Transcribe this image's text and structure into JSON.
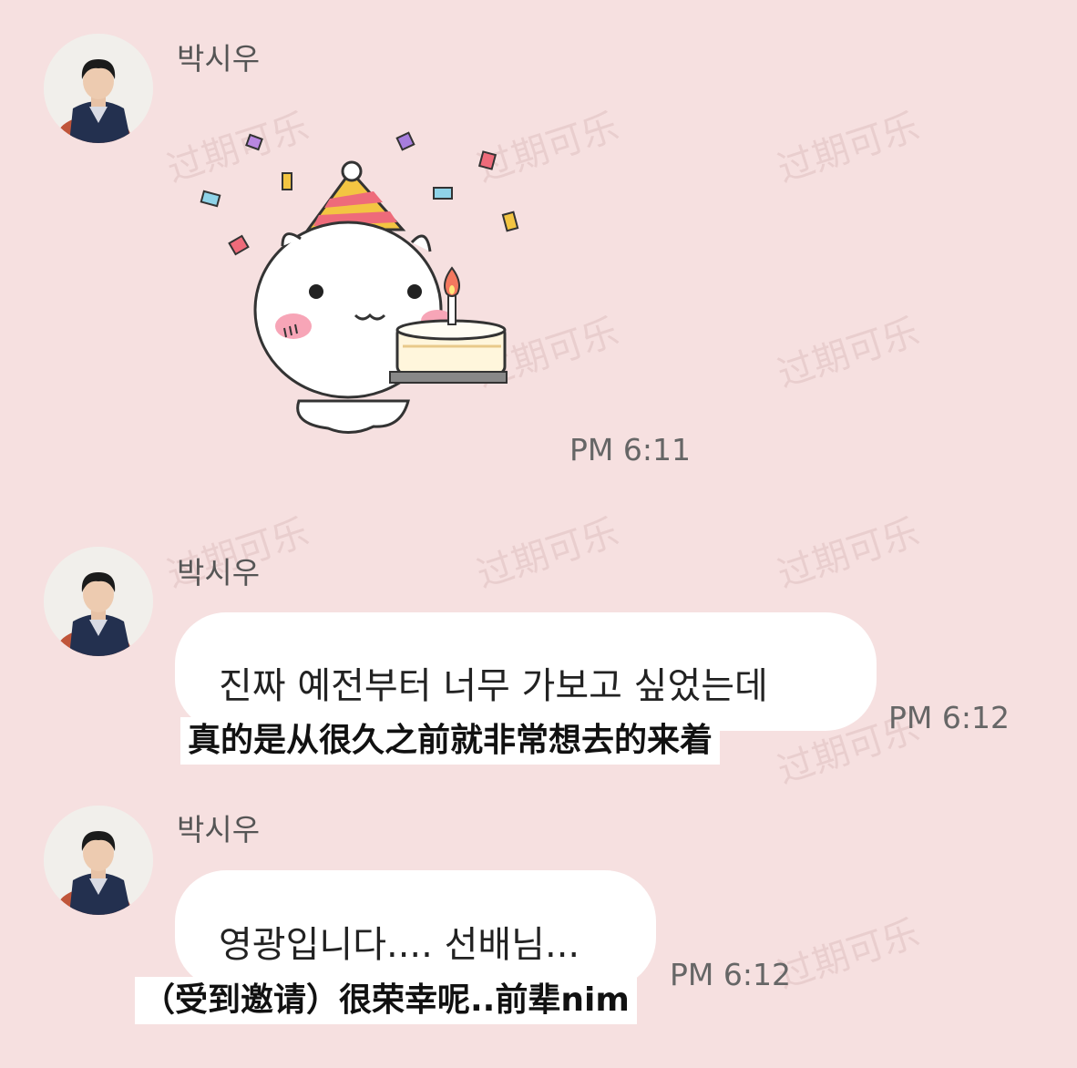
{
  "watermark": {
    "text": "过期可乐"
  },
  "messages": [
    {
      "sender": "박시우",
      "type": "sticker",
      "sticker_icon": "birthday-cake-sticker-icon",
      "time": "PM 6:11"
    },
    {
      "sender": "박시우",
      "type": "text",
      "text": "진짜 예전부터 너무 가보고 싶었는데",
      "subtitle": "真的是从很久之前就非常想去的来着",
      "time": "PM 6:12"
    },
    {
      "sender": "박시우",
      "type": "text",
      "text": "영광입니다.... 선배님...",
      "subtitle": "（受到邀请）很荣幸呢..前辈nim",
      "time": "PM 6:12"
    }
  ]
}
